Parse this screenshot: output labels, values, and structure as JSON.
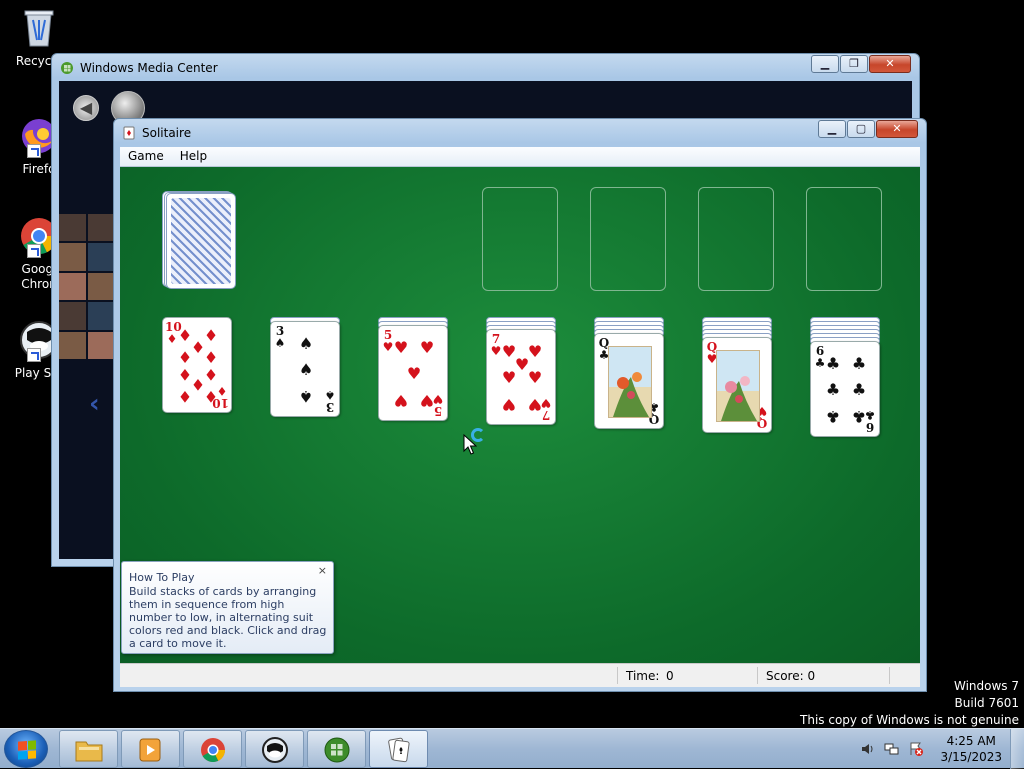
{
  "desktop": {
    "icons": [
      {
        "label": "Recycle"
      },
      {
        "label": "Firefo"
      },
      {
        "label": "Googl\nChron"
      },
      {
        "label": "Play Sto"
      }
    ],
    "watermark": {
      "line1": "Windows 7",
      "line2": "Build 7601",
      "line3": "This copy of Windows is not genuine"
    }
  },
  "media_center": {
    "title": "Windows Media Center"
  },
  "solitaire": {
    "title": "Solitaire",
    "menu": [
      "Game",
      "Help"
    ],
    "status": {
      "time_label": "Time:",
      "time_value": "0",
      "score_label": "Score: 0"
    },
    "tableau": [
      {
        "hidden": 0,
        "top_card": {
          "rank": "10",
          "suit": "diamonds",
          "suit_symbol": "♦",
          "color": "red"
        }
      },
      {
        "hidden": 1,
        "top_card": {
          "rank": "3",
          "suit": "spades",
          "suit_symbol": "♠",
          "color": "black"
        }
      },
      {
        "hidden": 2,
        "top_card": {
          "rank": "5",
          "suit": "hearts",
          "suit_symbol": "♥",
          "color": "red"
        }
      },
      {
        "hidden": 3,
        "top_card": {
          "rank": "7",
          "suit": "hearts",
          "suit_symbol": "♥",
          "color": "red"
        }
      },
      {
        "hidden": 4,
        "top_card": {
          "rank": "Q",
          "suit": "clubs",
          "suit_symbol": "♣",
          "color": "black"
        }
      },
      {
        "hidden": 5,
        "top_card": {
          "rank": "Q",
          "suit": "hearts",
          "suit_symbol": "♥",
          "color": "red"
        }
      },
      {
        "hidden": 6,
        "top_card": {
          "rank": "6",
          "suit": "clubs",
          "suit_symbol": "♣",
          "color": "black"
        }
      }
    ],
    "foundations": 4,
    "how_to_play": {
      "title": "How To Play",
      "text": "Build stacks of cards by arranging them in sequence from high number to low, in alternating suit colors red and black. Click and drag a card to move it.",
      "close": "×"
    }
  },
  "taskbar": {
    "apps": [
      "explorer-icon",
      "media-player-icon",
      "chrome-icon",
      "play-store-icon",
      "media-center-icon",
      "solitaire-icon"
    ],
    "active_app": "solitaire-icon",
    "clock": {
      "time": "4:25 AM",
      "date": "3/15/2023"
    }
  },
  "colors": {
    "felt": "#0d6a2a",
    "red_suit": "#d4121c",
    "black_suit": "#111111"
  }
}
